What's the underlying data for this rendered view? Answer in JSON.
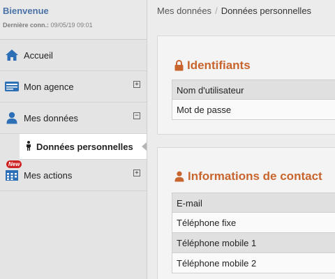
{
  "user": {
    "welcome": "Bienvenue",
    "last_conn_label": "Dernière conn.:",
    "last_conn_value": "09/05/19 09:01"
  },
  "sidebar": {
    "items": [
      {
        "label": "Accueil",
        "icon": "home-icon"
      },
      {
        "label": "Mon agence",
        "icon": "agency-card-icon",
        "toggle": "+"
      },
      {
        "label": "Mes données",
        "icon": "user-icon",
        "toggle": "−"
      },
      {
        "label": "Mes actions",
        "icon": "calendar-icon",
        "toggle": "+",
        "badge": "New"
      }
    ],
    "sub_item": {
      "label": "Données personnelles",
      "icon": "person-icon"
    }
  },
  "breadcrumb": {
    "parent": "Mes données",
    "separator": "/",
    "current": "Données personnelles"
  },
  "identifiants": {
    "title": "Identifiants",
    "icon": "lock-icon",
    "rows": [
      "Nom d'utilisateur",
      "Mot de passe"
    ]
  },
  "contact": {
    "title": "Informations de contact",
    "icon": "user-icon",
    "rows": [
      "E-mail",
      "Téléphone fixe",
      "Téléphone mobile 1",
      "Téléphone mobile 2"
    ]
  },
  "colors": {
    "accent": "#c8652e",
    "link": "#4a72a7",
    "icon_blue": "#2d6fb6",
    "badge": "#cc2222"
  }
}
